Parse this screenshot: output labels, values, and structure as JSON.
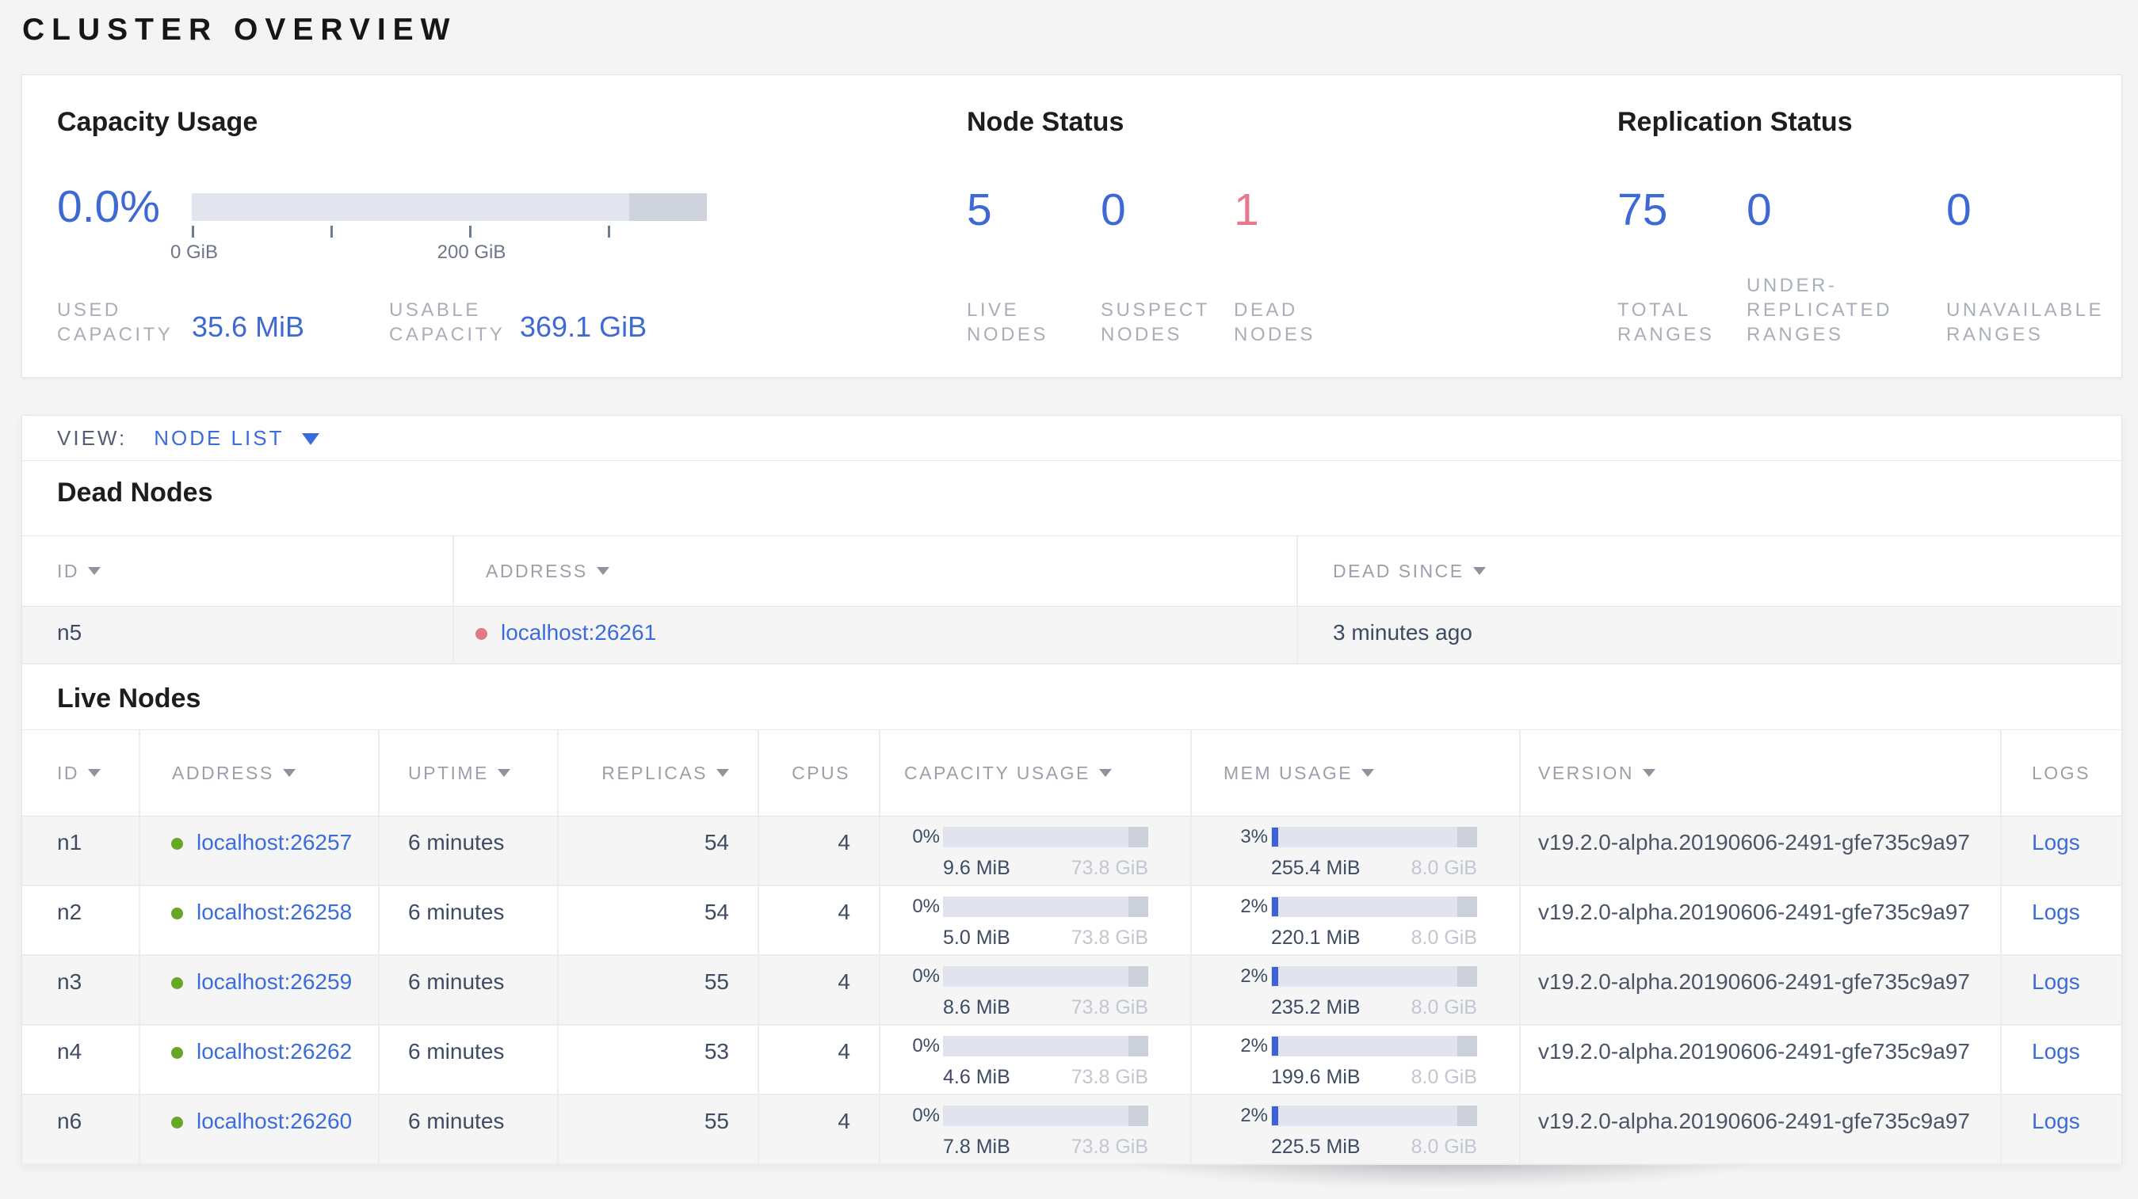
{
  "page": {
    "title": "CLUSTER OVERVIEW"
  },
  "colors": {
    "accent_blue": "#3e68d4",
    "link_blue": "#3b6cdb",
    "danger_red": "#e8798c",
    "dead_dot_red": "#e1798a",
    "live_dot_green": "#68a724"
  },
  "summary": {
    "capacity_usage": {
      "heading": "Capacity Usage",
      "percent": "0.0%",
      "axis_labels": [
        "0 GiB",
        "200 GiB"
      ],
      "used": {
        "label_lines": [
          "USED",
          "CAPACITY"
        ],
        "value": "35.6 MiB"
      },
      "usable": {
        "label_lines": [
          "USABLE",
          "CAPACITY"
        ],
        "value": "369.1 GiB"
      }
    },
    "node_status": {
      "heading": "Node Status",
      "stats": [
        {
          "value": "5",
          "label_lines": [
            "LIVE",
            "NODES"
          ],
          "color": "blue"
        },
        {
          "value": "0",
          "label_lines": [
            "SUSPECT",
            "NODES"
          ],
          "color": "blue"
        },
        {
          "value": "1",
          "label_lines": [
            "DEAD",
            "NODES"
          ],
          "color": "red"
        }
      ]
    },
    "replication_status": {
      "heading": "Replication Status",
      "stats": [
        {
          "value": "75",
          "label_lines": [
            "TOTAL",
            "RANGES"
          ],
          "color": "blue"
        },
        {
          "value": "0",
          "label_lines": [
            "UNDER-",
            "REPLICATED",
            "RANGES"
          ],
          "color": "blue"
        },
        {
          "value": "0",
          "label_lines": [
            "UNAVAILABLE",
            "RANGES"
          ],
          "color": "blue"
        }
      ]
    }
  },
  "view_bar": {
    "label": "VIEW:",
    "selected": "NODE LIST"
  },
  "dead_nodes": {
    "heading": "Dead Nodes",
    "columns": [
      {
        "label": "ID",
        "sortable": true
      },
      {
        "label": "ADDRESS",
        "sortable": true
      },
      {
        "label": "DEAD SINCE",
        "sortable": true
      }
    ],
    "rows": [
      {
        "id": "n5",
        "address": "localhost:26261",
        "dead_since": "3 minutes ago"
      }
    ]
  },
  "live_nodes": {
    "heading": "Live Nodes",
    "columns": [
      {
        "label": "ID",
        "sortable": true
      },
      {
        "label": "ADDRESS",
        "sortable": true
      },
      {
        "label": "UPTIME",
        "sortable": true
      },
      {
        "label": "REPLICAS",
        "sortable": true
      },
      {
        "label": "CPUS",
        "sortable": false
      },
      {
        "label": "CAPACITY USAGE",
        "sortable": true
      },
      {
        "label": "MEM USAGE",
        "sortable": true
      },
      {
        "label": "VERSION",
        "sortable": true
      },
      {
        "label": "LOGS",
        "sortable": false
      }
    ],
    "rows": [
      {
        "id": "n1",
        "address": "localhost:26257",
        "uptime": "6 minutes",
        "replicas": "54",
        "cpus": "4",
        "capacity": {
          "percent": "0%",
          "used": "9.6 MiB",
          "total": "73.8 GiB",
          "fill_pct": 0
        },
        "memory": {
          "percent": "3%",
          "used": "255.4 MiB",
          "total": "8.0 GiB",
          "fill_pct": 3
        },
        "version": "v19.2.0-alpha.20190606-2491-gfe735c9a97",
        "logs_label": "Logs"
      },
      {
        "id": "n2",
        "address": "localhost:26258",
        "uptime": "6 minutes",
        "replicas": "54",
        "cpus": "4",
        "capacity": {
          "percent": "0%",
          "used": "5.0 MiB",
          "total": "73.8 GiB",
          "fill_pct": 0
        },
        "memory": {
          "percent": "2%",
          "used": "220.1 MiB",
          "total": "8.0 GiB",
          "fill_pct": 2
        },
        "version": "v19.2.0-alpha.20190606-2491-gfe735c9a97",
        "logs_label": "Logs"
      },
      {
        "id": "n3",
        "address": "localhost:26259",
        "uptime": "6 minutes",
        "replicas": "55",
        "cpus": "4",
        "capacity": {
          "percent": "0%",
          "used": "8.6 MiB",
          "total": "73.8 GiB",
          "fill_pct": 0
        },
        "memory": {
          "percent": "2%",
          "used": "235.2 MiB",
          "total": "8.0 GiB",
          "fill_pct": 2
        },
        "version": "v19.2.0-alpha.20190606-2491-gfe735c9a97",
        "logs_label": "Logs"
      },
      {
        "id": "n4",
        "address": "localhost:26262",
        "uptime": "6 minutes",
        "replicas": "53",
        "cpus": "4",
        "capacity": {
          "percent": "0%",
          "used": "4.6 MiB",
          "total": "73.8 GiB",
          "fill_pct": 0
        },
        "memory": {
          "percent": "2%",
          "used": "199.6 MiB",
          "total": "8.0 GiB",
          "fill_pct": 2
        },
        "version": "v19.2.0-alpha.20190606-2491-gfe735c9a97",
        "logs_label": "Logs"
      },
      {
        "id": "n6",
        "address": "localhost:26260",
        "uptime": "6 minutes",
        "replicas": "55",
        "cpus": "4",
        "capacity": {
          "percent": "0%",
          "used": "7.8 MiB",
          "total": "73.8 GiB",
          "fill_pct": 0
        },
        "memory": {
          "percent": "2%",
          "used": "225.5 MiB",
          "total": "8.0 GiB",
          "fill_pct": 2
        },
        "version": "v19.2.0-alpha.20190606-2491-gfe735c9a97",
        "logs_label": "Logs"
      }
    ]
  }
}
